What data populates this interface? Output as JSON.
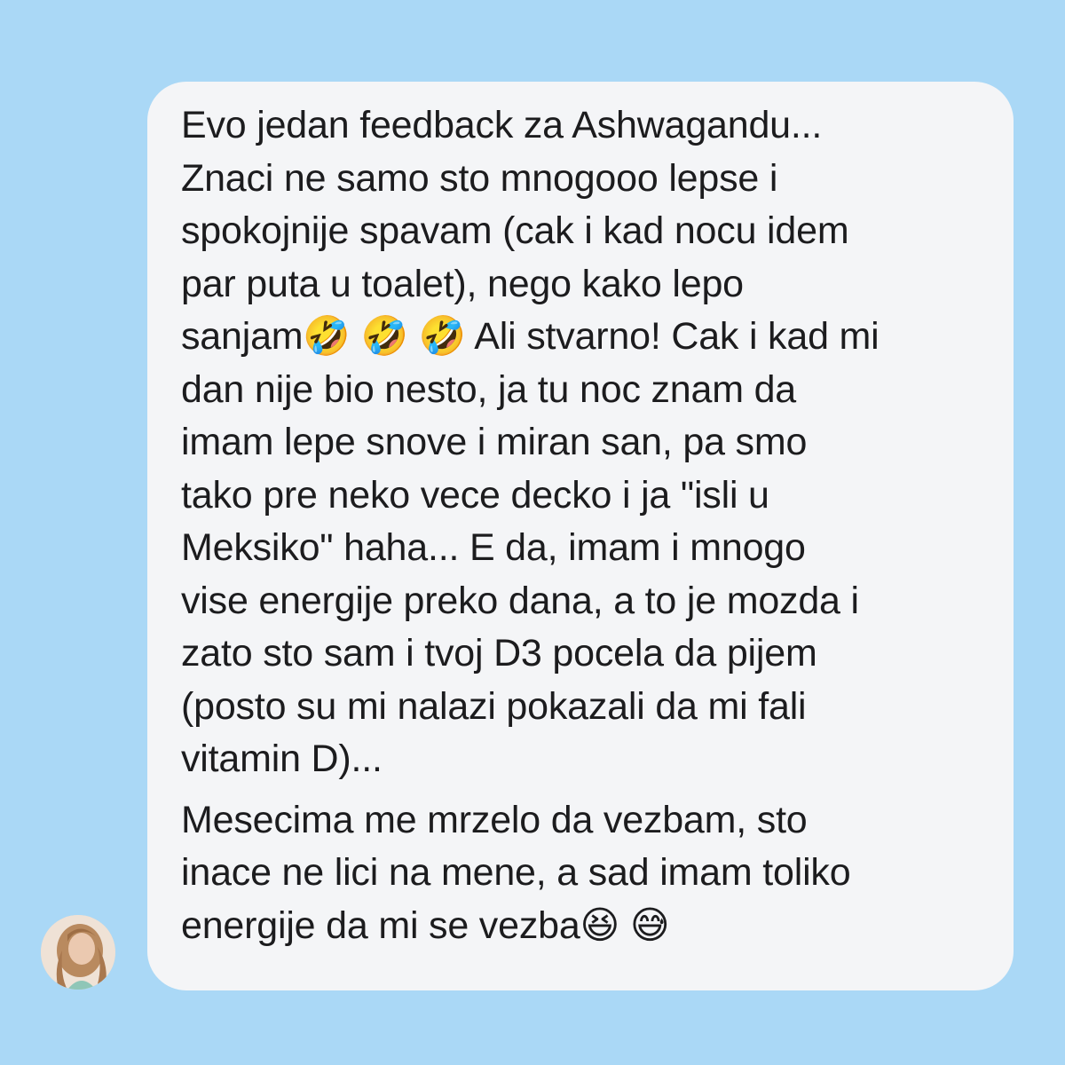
{
  "message": {
    "paragraph_1": [
      "Evo jedan feedback za Ashwagandu...",
      "Znaci ne samo sto mnogooo lepse i",
      "spokojnije spavam (cak i kad nocu idem",
      "par puta u toalet), nego kako lepo",
      "sanjam🤣 🤣 🤣  Ali stvarno! Cak i kad mi",
      "dan nije bio nesto, ja tu noc znam da",
      "imam lepe snove i miran san, pa smo",
      "tako pre neko vece decko i ja \"isli u",
      "Meksiko\" haha... E da, imam i mnogo",
      "vise energije preko dana, a to je mozda i",
      "zato sto sam i tvoj D3 pocela da pijem",
      "(posto su mi nalazi pokazali da mi fali",
      "vitamin D)..."
    ],
    "paragraph_2": [
      "Mesecima me mrzelo da vezbam, sto",
      "inace ne lici na mene, a sad imam toliko",
      "energije da mi se vezba😆 😅"
    ]
  },
  "colors": {
    "background": "#aad8f6",
    "bubble": "#f4f5f7",
    "text": "#1c1c1e"
  },
  "avatar": {
    "icon": "avatar-photo"
  }
}
